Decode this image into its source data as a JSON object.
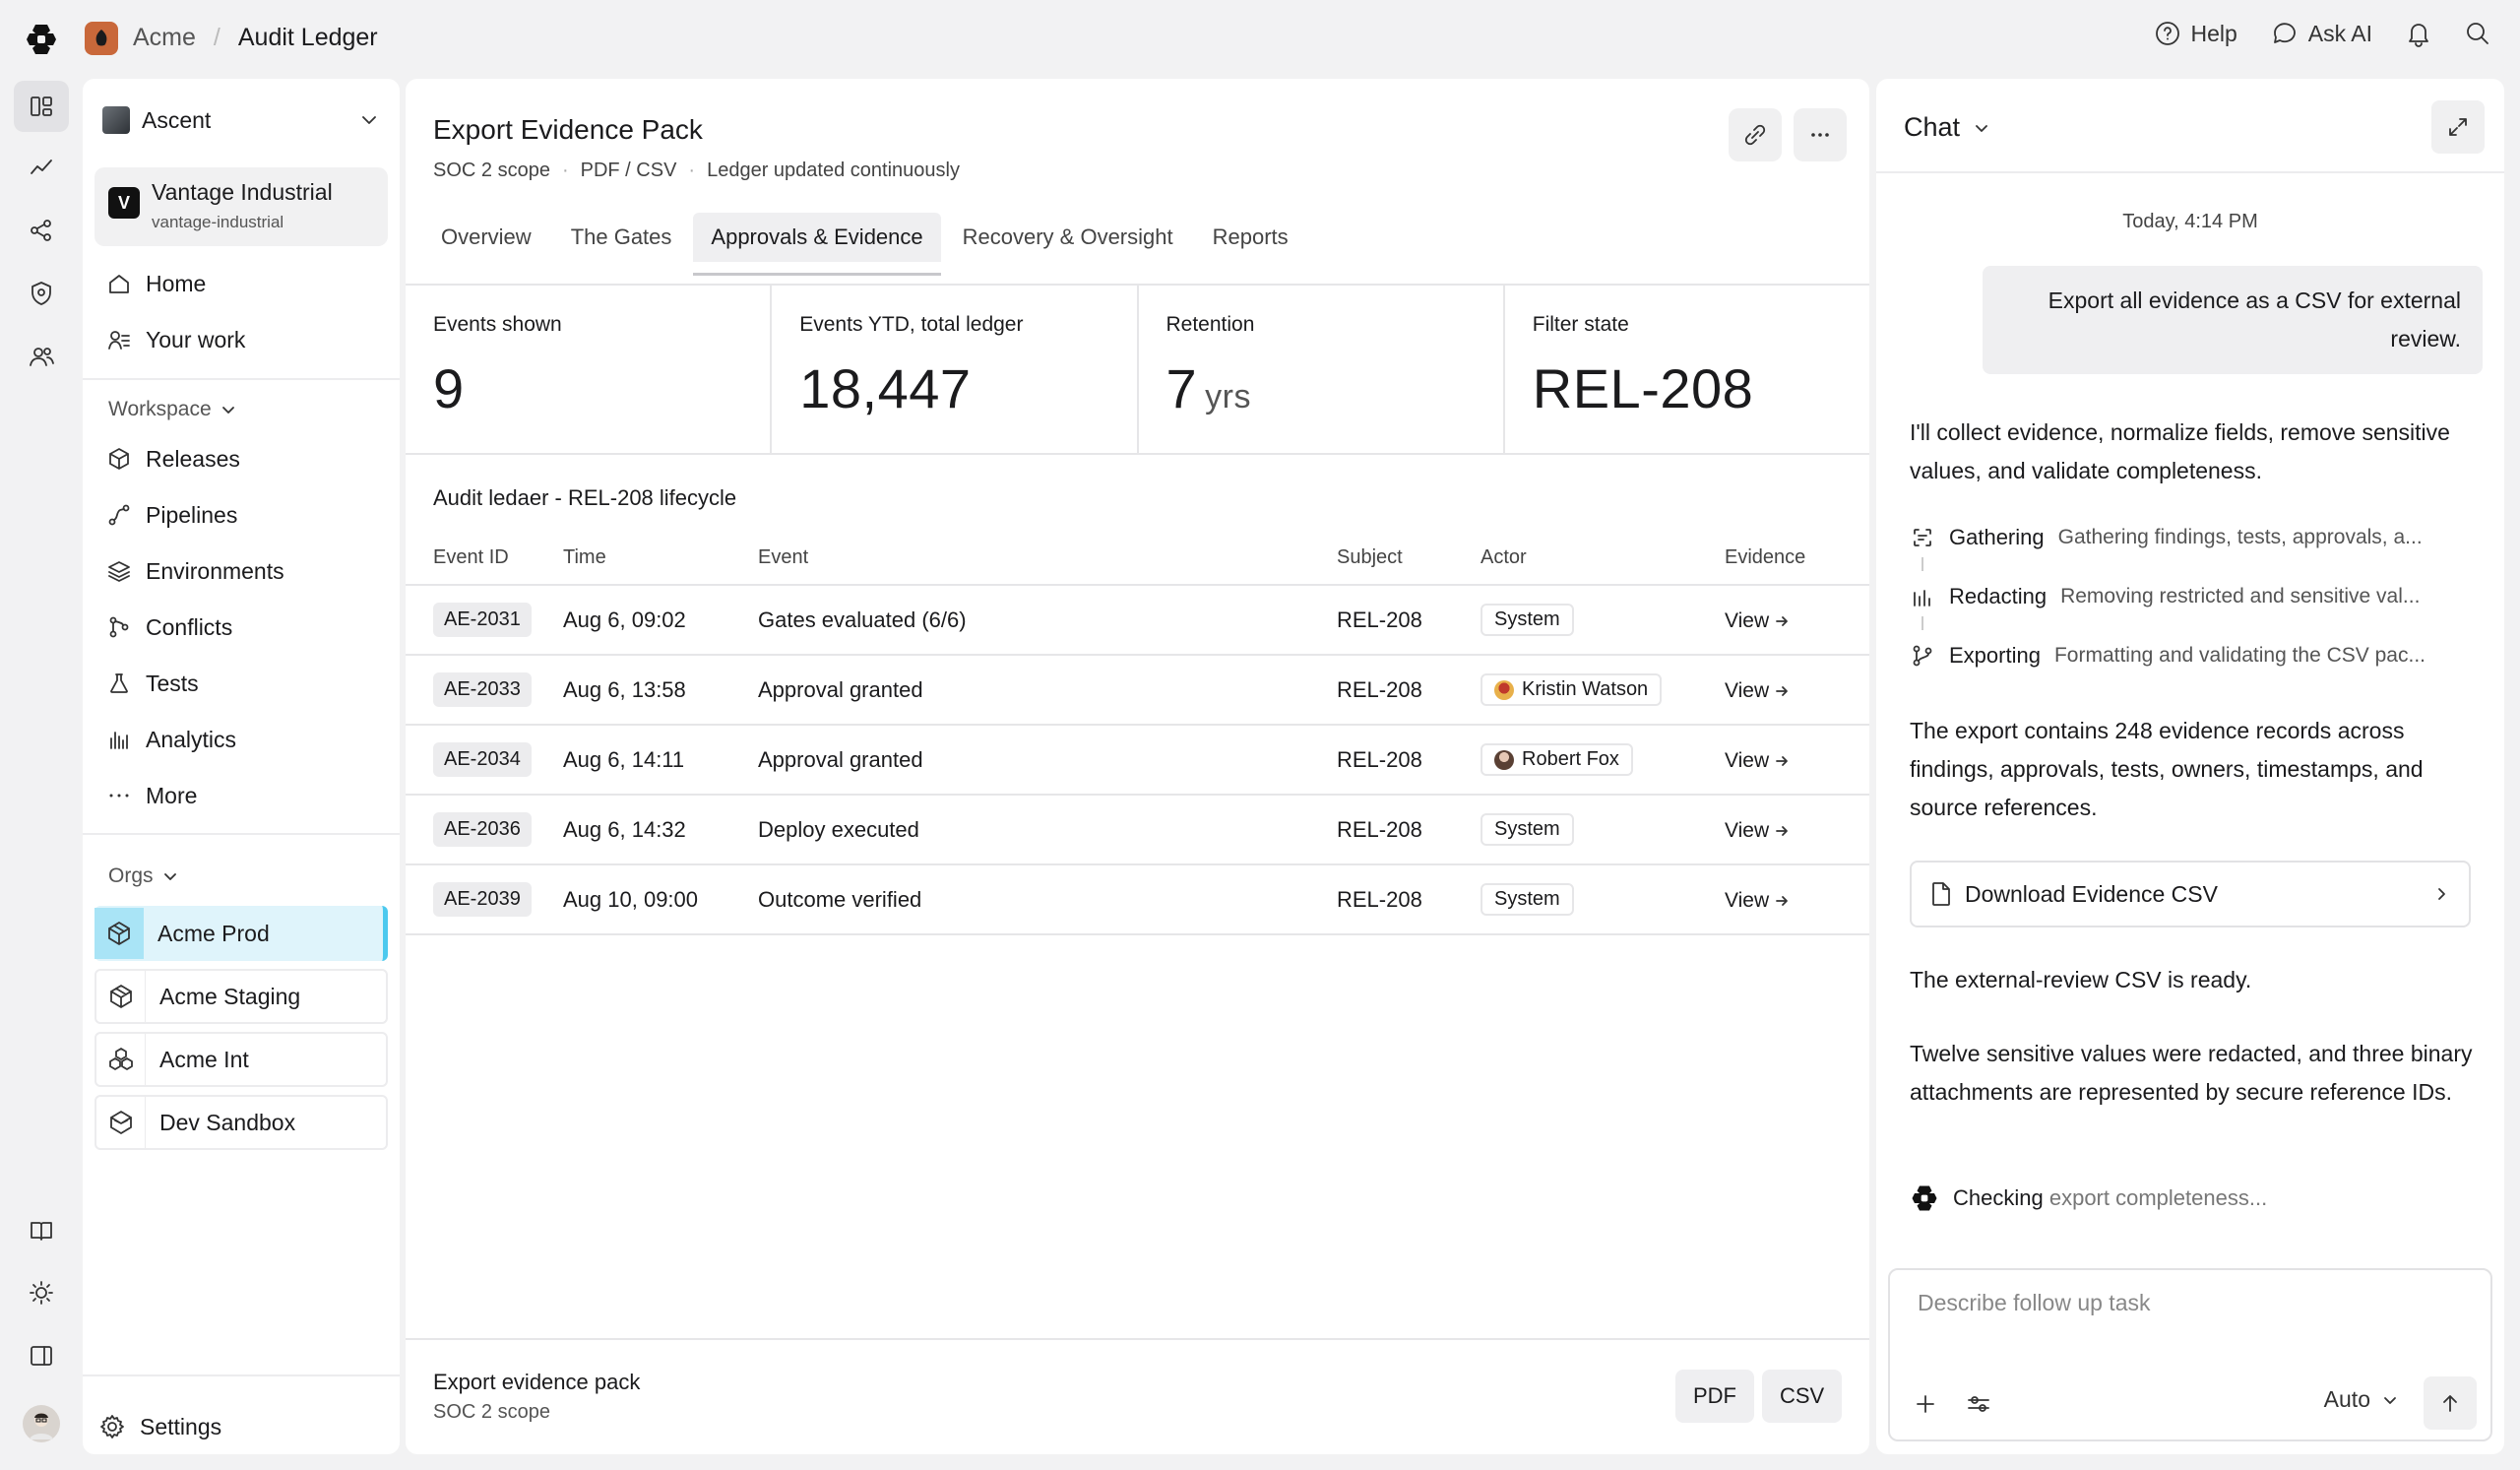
{
  "topbar": {
    "org": "Acme",
    "separator": "/",
    "page": "Audit Ledger",
    "help_label": "Help",
    "ask_ai_label": "Ask AI"
  },
  "sidebar": {
    "workspace_name": "Ascent",
    "project": {
      "badge": "V",
      "name": "Vantage Industrial",
      "slug": "vantage-industrial"
    },
    "primary": [
      {
        "label": "Home",
        "icon": "home-icon"
      },
      {
        "label": "Your work",
        "icon": "your-work-icon"
      }
    ],
    "workspace_label": "Workspace",
    "workspace_items": [
      {
        "label": "Releases",
        "icon": "package-icon"
      },
      {
        "label": "Pipelines",
        "icon": "pipeline-icon"
      },
      {
        "label": "Environments",
        "icon": "layers-icon"
      },
      {
        "label": "Conflicts",
        "icon": "merge-icon"
      },
      {
        "label": "Tests",
        "icon": "flask-icon"
      },
      {
        "label": "Analytics",
        "icon": "bar-chart-icon"
      },
      {
        "label": "More",
        "icon": "more-dots-icon"
      }
    ],
    "orgs_label": "Orgs",
    "orgs": [
      {
        "label": "Acme Prod",
        "active": true
      },
      {
        "label": "Acme Staging",
        "active": false
      },
      {
        "label": "Acme Int",
        "active": false
      },
      {
        "label": "Dev Sandbox",
        "active": false
      }
    ],
    "settings_label": "Settings"
  },
  "main": {
    "title": "Export Evidence Pack",
    "meta": [
      "SOC 2 scope",
      "PDF / CSV",
      "Ledger updated continuously"
    ],
    "tabs": [
      {
        "label": "Overview",
        "active": false
      },
      {
        "label": "The Gates",
        "active": false
      },
      {
        "label": "Approvals & Evidence",
        "active": true
      },
      {
        "label": "Recovery & Oversight",
        "active": false
      },
      {
        "label": "Reports",
        "active": false
      }
    ],
    "stats": [
      {
        "label": "Events shown",
        "value": "9",
        "unit": ""
      },
      {
        "label": "Events YTD, total ledger",
        "value": "18,447",
        "unit": ""
      },
      {
        "label": "Retention",
        "value": "7",
        "unit": "yrs"
      },
      {
        "label": "Filter state",
        "value": "REL-208",
        "unit": ""
      }
    ],
    "ledger_title": "Audit ledaer - REL-208 lifecycle",
    "columns": [
      "Event ID",
      "Time",
      "Event",
      "Subject",
      "Actor",
      "Evidence"
    ],
    "rows": [
      {
        "id": "AE-2031",
        "time": "Aug 6, 09:02",
        "event": "Gates evaluated (6/6)",
        "subject": "REL-208",
        "actor": "System",
        "avatar": "",
        "evidence": "View"
      },
      {
        "id": "AE-2033",
        "time": "Aug 6, 13:58",
        "event": "Approval granted",
        "subject": "REL-208",
        "actor": "Kristin Watson",
        "avatar": "#e8b04a",
        "evidence": "View"
      },
      {
        "id": "AE-2034",
        "time": "Aug 6, 14:11",
        "event": "Approval granted",
        "subject": "REL-208",
        "actor": "Robert Fox",
        "avatar": "#7a5a4a",
        "evidence": "View"
      },
      {
        "id": "AE-2036",
        "time": "Aug 6, 14:32",
        "event": "Deploy executed",
        "subject": "REL-208",
        "actor": "System",
        "avatar": "",
        "evidence": "View"
      },
      {
        "id": "AE-2039",
        "time": "Aug 10, 09:00",
        "event": "Outcome verified",
        "subject": "REL-208",
        "actor": "System",
        "avatar": "",
        "evidence": "View"
      }
    ],
    "footer": {
      "title": "Export evidence pack",
      "subtitle": "SOC 2 scope",
      "pdf_label": "PDF",
      "csv_label": "CSV"
    }
  },
  "chat": {
    "title": "Chat",
    "timestamp": "Today, 4:14 PM",
    "user_message": "Export all evidence as a CSV for external review.",
    "intro": "I'll collect evidence, normalize fields, remove sensitive values, and validate completeness.",
    "steps": [
      {
        "name": "Gathering",
        "desc": "Gathering findings, tests, approvals, a...",
        "icon": "scan-icon"
      },
      {
        "name": "Redacting",
        "desc": "Removing restricted and sensitive val...",
        "icon": "bars-icon"
      },
      {
        "name": "Exporting",
        "desc": "Formatting and validating the CSV pac...",
        "icon": "branch-icon"
      }
    ],
    "summary": "The export contains 248 evidence records across findings, approvals, tests, owners, timestamps, and source references.",
    "download_label": "Download Evidence CSV",
    "ready": "The external-review CSV is ready.",
    "detail": "Twelve sensitive values were redacted, and three binary attachments are represented by secure reference IDs.",
    "checking_a": "Checking",
    "checking_b": "export completeness...",
    "composer_placeholder": "Describe follow up task",
    "mode": "Auto"
  },
  "colors": {
    "accent_active_org": "#a9e4f6",
    "accent_border": "#4cc9ee",
    "brand_avatar": "#c9683a"
  }
}
